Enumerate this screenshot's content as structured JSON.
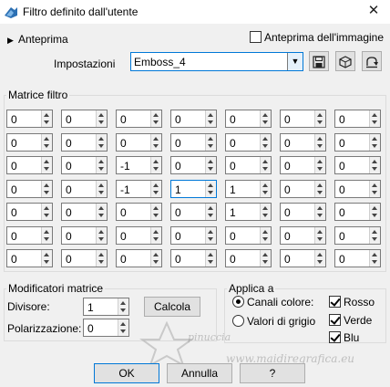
{
  "window": {
    "title": "Filtro definito dall'utente",
    "close": "✕"
  },
  "preview": {
    "toggle_label": "Anteprima",
    "image_preview_label": "Anteprima dell'immagine",
    "image_preview_checked": false
  },
  "settings": {
    "label": "Impostazioni",
    "preset_value": "Emboss_4"
  },
  "matrix": {
    "title": "Matrice filtro",
    "values": [
      [
        "0",
        "0",
        "0",
        "0",
        "0",
        "0",
        "0"
      ],
      [
        "0",
        "0",
        "0",
        "0",
        "0",
        "0",
        "0"
      ],
      [
        "0",
        "0",
        "-1",
        "0",
        "0",
        "0",
        "0"
      ],
      [
        "0",
        "0",
        "-1",
        "1",
        "1",
        "0",
        "0"
      ],
      [
        "0",
        "0",
        "0",
        "0",
        "1",
        "0",
        "0"
      ],
      [
        "0",
        "0",
        "0",
        "0",
        "0",
        "0",
        "0"
      ],
      [
        "0",
        "0",
        "0",
        "0",
        "0",
        "0",
        "0"
      ]
    ],
    "active_cell": [
      3,
      3
    ]
  },
  "modifiers": {
    "title": "Modificatori matrice",
    "divisor_label": "Divisore:",
    "divisor_value": "1",
    "calc_button": "Calcola",
    "bias_label": "Polarizzazione:",
    "bias_value": "0"
  },
  "apply": {
    "title": "Applica a",
    "color_channels": "Canali colore:",
    "gray_values": "Valori di grigio",
    "selected": "color_channels",
    "red": "Rosso",
    "green": "Verde",
    "blue": "Blu"
  },
  "buttons": {
    "ok": "OK",
    "cancel": "Annulla",
    "help": "?"
  },
  "watermark": {
    "line1": "pinuccia",
    "line2": "www.maidiregrafica.eu"
  }
}
